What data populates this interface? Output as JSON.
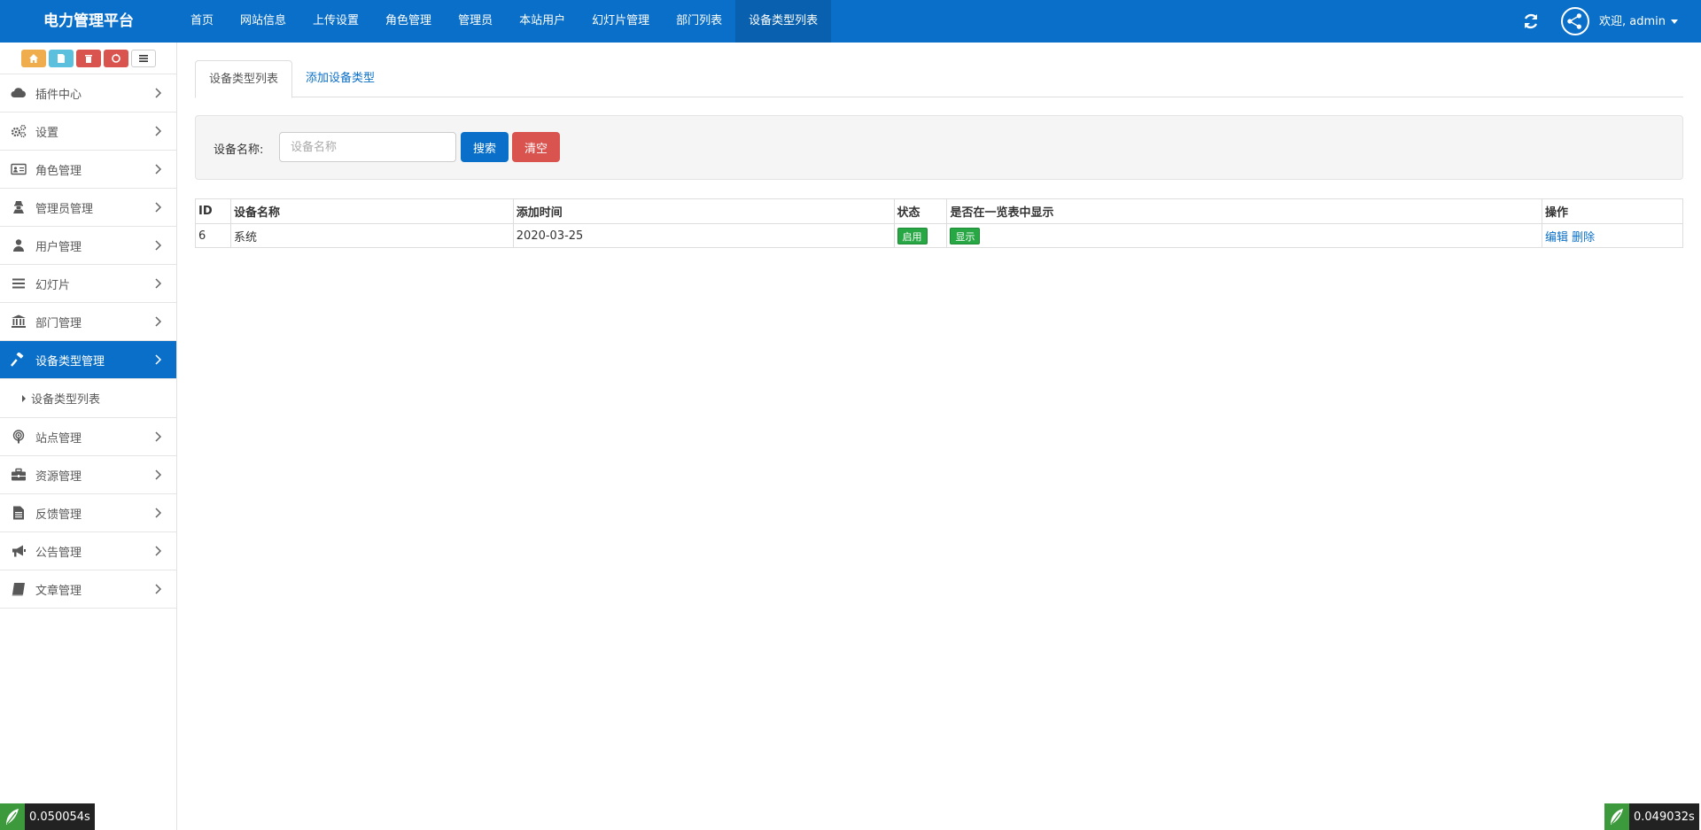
{
  "app": {
    "title": "电力管理平台"
  },
  "topnav": {
    "items": [
      {
        "label": "首页"
      },
      {
        "label": "网站信息"
      },
      {
        "label": "上传设置"
      },
      {
        "label": "角色管理"
      },
      {
        "label": "管理员"
      },
      {
        "label": "本站用户"
      },
      {
        "label": "幻灯片管理"
      },
      {
        "label": "部门列表"
      },
      {
        "label": "设备类型列表"
      }
    ],
    "active_index": 8,
    "user_label": "欢迎, admin"
  },
  "sidebar": {
    "shortcut_colors": [
      "#f0ad4e",
      "#5bc0de",
      "#d9534f",
      "#d9534f",
      "#ffffff"
    ],
    "items": [
      {
        "label": "插件中心",
        "icon": "cloud-icon"
      },
      {
        "label": "设置",
        "icon": "gears-icon"
      },
      {
        "label": "角色管理",
        "icon": "id-card-icon"
      },
      {
        "label": "管理员管理",
        "icon": "user-secret-icon"
      },
      {
        "label": "用户管理",
        "icon": "user-icon"
      },
      {
        "label": "幻灯片",
        "icon": "list-icon"
      },
      {
        "label": "部门管理",
        "icon": "bank-icon"
      },
      {
        "label": "设备类型管理",
        "icon": "gavel-icon",
        "active": true
      },
      {
        "label": "站点管理",
        "icon": "podcast-icon"
      },
      {
        "label": "资源管理",
        "icon": "briefcase-icon"
      },
      {
        "label": "反馈管理",
        "icon": "file-text-icon"
      },
      {
        "label": "公告管理",
        "icon": "bullhorn-icon"
      },
      {
        "label": "文章管理",
        "icon": "book-icon"
      }
    ],
    "submenu": {
      "label": "设备类型列表"
    }
  },
  "main": {
    "tabs": [
      {
        "label": "设备类型列表"
      },
      {
        "label": "添加设备类型"
      }
    ],
    "search": {
      "label": "设备名称:",
      "placeholder": "设备名称",
      "search_button": "搜索",
      "clear_button": "清空"
    },
    "table": {
      "headers": [
        "ID",
        "设备名称",
        "添加时间",
        "状态",
        "是否在一览表中显示",
        "操作"
      ],
      "rows": [
        {
          "id": "6",
          "name": "系统",
          "date": "2020-03-25",
          "status": "启用",
          "display": "显示",
          "edit": "编辑",
          "delete": "删除"
        }
      ]
    }
  },
  "timers": {
    "left": "0.050054s",
    "right": "0.049032s"
  },
  "colors": {
    "primary": "#0a6fc8",
    "danger": "#d9534f",
    "success": "#28a745"
  }
}
